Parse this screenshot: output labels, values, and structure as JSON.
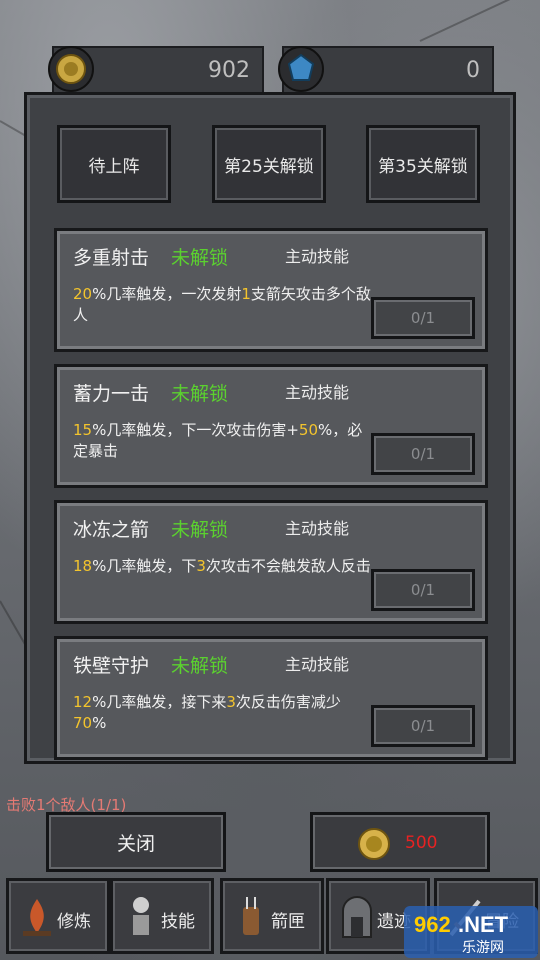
{
  "currency": {
    "coins": "902",
    "gems": "0"
  },
  "tabs": [
    "待上阵",
    "第25关解锁",
    "第35关解锁"
  ],
  "skills": [
    {
      "name": "多重射击",
      "status": "未解锁",
      "type": "主动技能",
      "desc": [
        {
          "t": "20",
          "h": true
        },
        {
          "t": "%几率触发，一次发射",
          "h": false
        },
        {
          "t": "1",
          "h": true
        },
        {
          "t": "支箭矢攻击多个敌人",
          "h": false
        }
      ],
      "progress": "0/1"
    },
    {
      "name": "蓄力一击",
      "status": "未解锁",
      "type": "主动技能",
      "desc": [
        {
          "t": "15",
          "h": true
        },
        {
          "t": "%几率触发，下一次攻击伤害+",
          "h": false
        },
        {
          "t": "50",
          "h": true
        },
        {
          "t": "%，必定暴击",
          "h": false
        }
      ],
      "progress": "0/1"
    },
    {
      "name": "冰冻之箭",
      "status": "未解锁",
      "type": "主动技能",
      "desc": [
        {
          "t": "18",
          "h": true
        },
        {
          "t": "%几率触发，下",
          "h": false
        },
        {
          "t": "3",
          "h": true
        },
        {
          "t": "次攻击不会触发敌人反击",
          "h": false
        }
      ],
      "progress": "0/1"
    },
    {
      "name": "铁壁守护",
      "status": "未解锁",
      "type": "主动技能",
      "desc": [
        {
          "t": "12",
          "h": true
        },
        {
          "t": "%几率触发，接下来",
          "h": false
        },
        {
          "t": "3",
          "h": true
        },
        {
          "t": "次反击伤害减少",
          "h": false
        },
        {
          "t": "70",
          "h": true
        },
        {
          "t": "%",
          "h": false
        }
      ],
      "progress": "0/1"
    }
  ],
  "kill_text": "击败1个敌人(1/1)",
  "close_label": "关闭",
  "buy_price": "500",
  "nav": [
    {
      "label": "修炼",
      "icon": "campfire-icon"
    },
    {
      "label": "技能",
      "icon": "skeleton-icon"
    },
    {
      "label": "箭匣",
      "icon": "quiver-icon"
    },
    {
      "label": "遗迹",
      "icon": "gate-icon"
    },
    {
      "label": "冒险",
      "icon": "sword-icon"
    }
  ],
  "watermark": {
    "brand": "962",
    "tld": ".NET",
    "sub": "乐游网"
  },
  "colors": {
    "unlock_status": "#5bd12f",
    "highlight": "#f3c42d",
    "price": "#e82222",
    "kill_text": "#e47a74"
  }
}
